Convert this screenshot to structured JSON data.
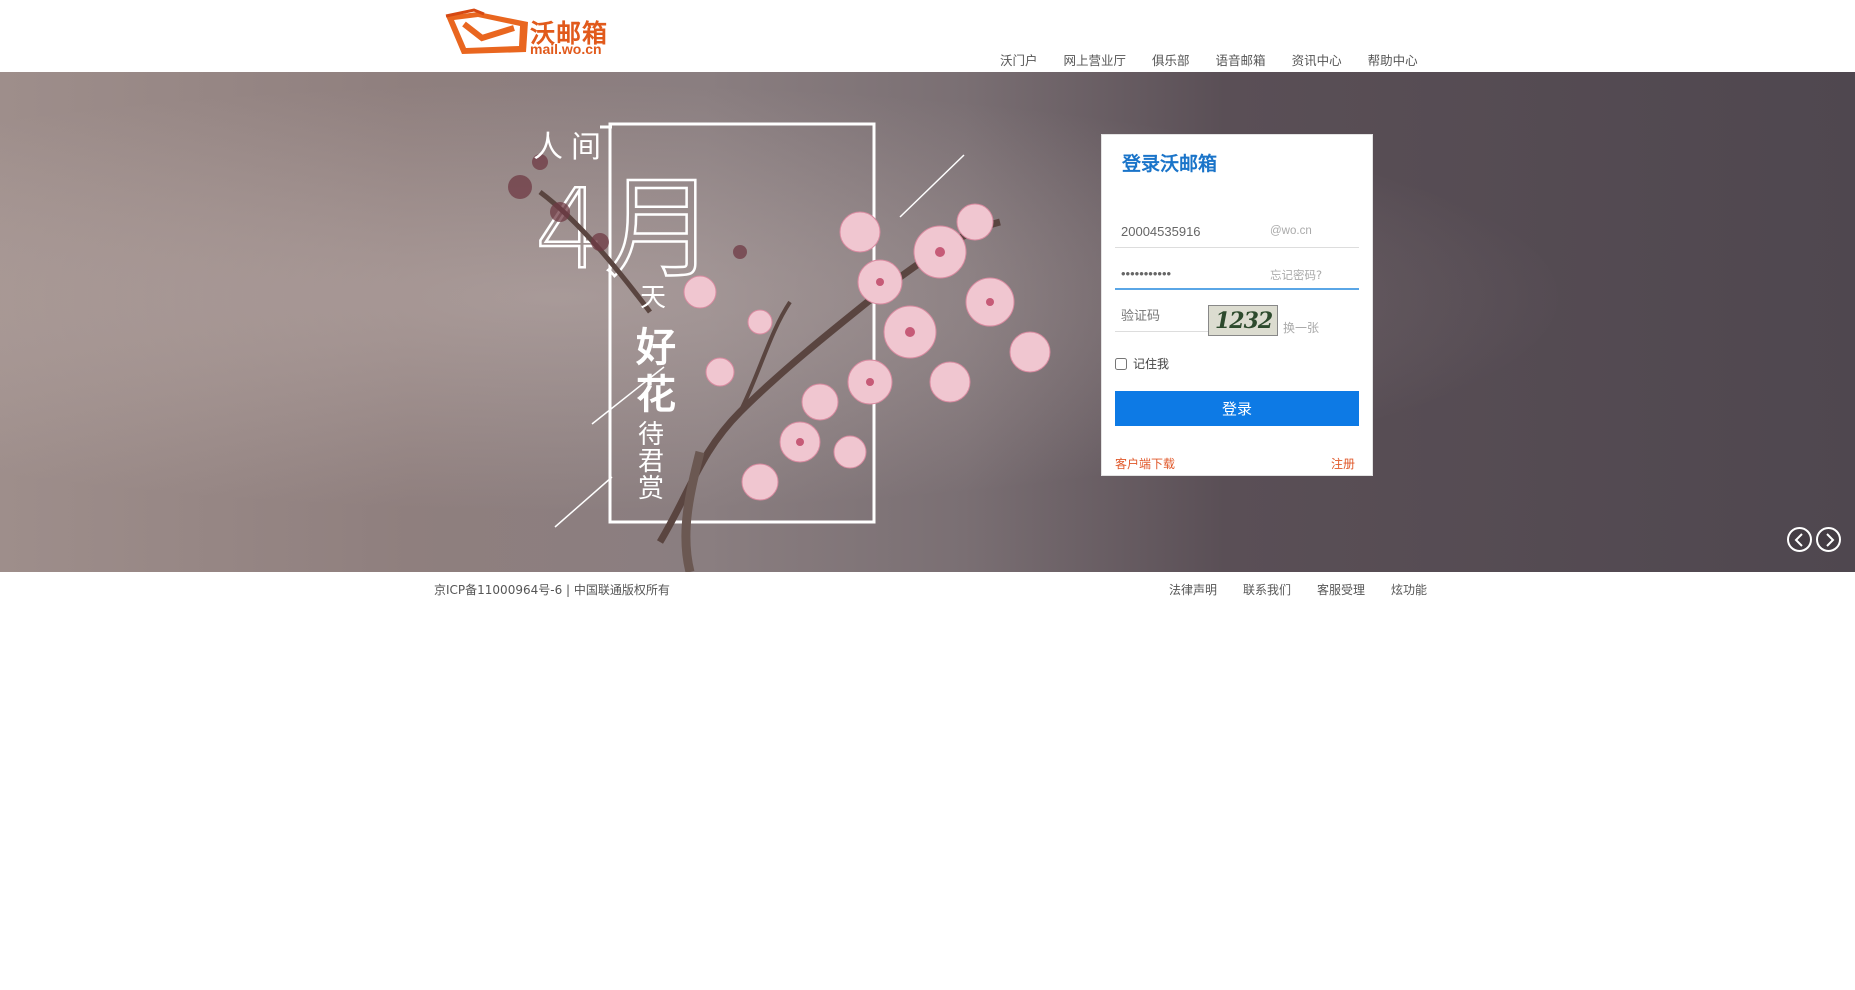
{
  "header": {
    "logo_title": "沃邮箱",
    "logo_domain": "mail.wo.cn",
    "nav": [
      "沃门户",
      "网上营业厅",
      "俱乐部",
      "语音邮箱",
      "资讯中心",
      "帮助中心"
    ]
  },
  "banner": {
    "poem_ren": "人间",
    "poem_month": "4月",
    "poem_tian": "天",
    "poem_hao": "好",
    "poem_hua": "花",
    "poem_dai": "待君赏"
  },
  "login": {
    "title": "登录沃邮箱",
    "username_value": "20004535916",
    "domain_suffix": "@wo.cn",
    "password_value": "•••••••••••",
    "forgot_label": "忘记密码?",
    "captcha_placeholder": "验证码",
    "captcha_text": "1232",
    "refresh_label": "换一张",
    "remember_label": "记住我",
    "submit_label": "登录",
    "client_download": "客户端下载",
    "register": "注册"
  },
  "footer": {
    "copyright": "京ICP备11000964号-6  |  中国联通版权所有",
    "nav": [
      "法律声明",
      "联系我们",
      "客服受理",
      "炫功能"
    ]
  },
  "colors": {
    "brand_orange": "#e15a1c",
    "login_blue": "#0d7ae5",
    "link_red": "#e0582a"
  }
}
